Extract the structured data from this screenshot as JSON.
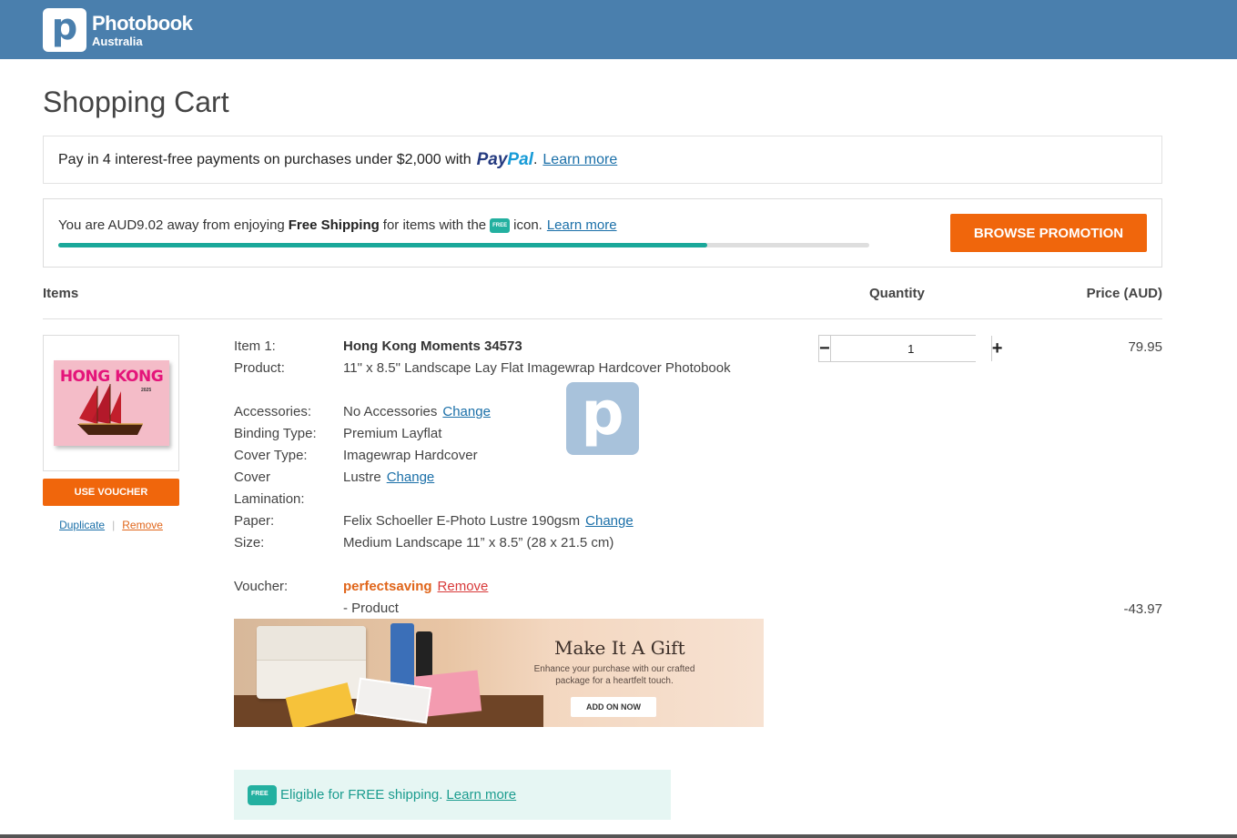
{
  "header": {
    "brand_name": "Photobook",
    "brand_sub": "Australia",
    "logo_letter": "p",
    "bg_color": "#4a7fad"
  },
  "page": {
    "title": "Shopping Cart"
  },
  "paypal": {
    "text": "Pay in 4 interest-free payments on purchases under $2,000 with",
    "logo_pay": "Pay",
    "logo_pal": "Pal",
    "dot": ".",
    "link": "Learn more"
  },
  "shipping": {
    "prefix": "You are AUD9.02 away from enjoying",
    "bold": "Free Shipping",
    "suffix": "for items with the",
    "icon_label": "FREE",
    "after_icon": "icon.",
    "link": "Learn more",
    "progress_fraction": 0.8,
    "button": "BROWSE PROMOTION",
    "accent": "#f0660c",
    "teal": "#1aa89a"
  },
  "columns": {
    "items": "Items",
    "quantity": "Quantity",
    "price": "Price (AUD)"
  },
  "item": {
    "thumb_title": "HONG KONG",
    "thumb_year": "2025",
    "voucher_button": "USE VOUCHER",
    "duplicate": "Duplicate",
    "separator": "|",
    "remove": "Remove",
    "rows": [
      {
        "label": "Item 1:",
        "value": "Hong Kong Moments 34573"
      },
      {
        "label": "Product:",
        "value": "11\" x 8.5\" Landscape Lay Flat Imagewrap Hardcover Photobook"
      },
      {
        "label": "Accessories:",
        "value": "No Accessories",
        "change": "Change"
      },
      {
        "label": "Binding Type:",
        "value": "Premium Layflat"
      },
      {
        "label": "Cover Type:",
        "value": "Imagewrap Hardcover"
      },
      {
        "label": "Cover Lamination:",
        "value": "Lustre",
        "change": "Change"
      },
      {
        "label": "Paper:",
        "value": "Felix Schoeller E-Photo Lustre 190gsm",
        "change": "Change"
      },
      {
        "label": "Size:",
        "value": "Medium Landscape 11” x 8.5” (28 x 21.5 cm)"
      }
    ],
    "voucher_label": "Voucher:",
    "voucher_code": "perfectsaving",
    "voucher_remove": "Remove",
    "voucher_note": "- Product",
    "badge_letter": "p",
    "quantity": "1",
    "qty_minus": "−",
    "qty_plus": "+",
    "price": "79.95",
    "discount": "-43.97"
  },
  "gift": {
    "title": "Make It A Gift",
    "subtitle": "Enhance your purchase with our crafted package for a heartfelt touch.",
    "button": "ADD ON NOW"
  },
  "free_shipping": {
    "icon_label": "FREE",
    "text": "Eligible for FREE shipping.",
    "link": "Learn more"
  }
}
